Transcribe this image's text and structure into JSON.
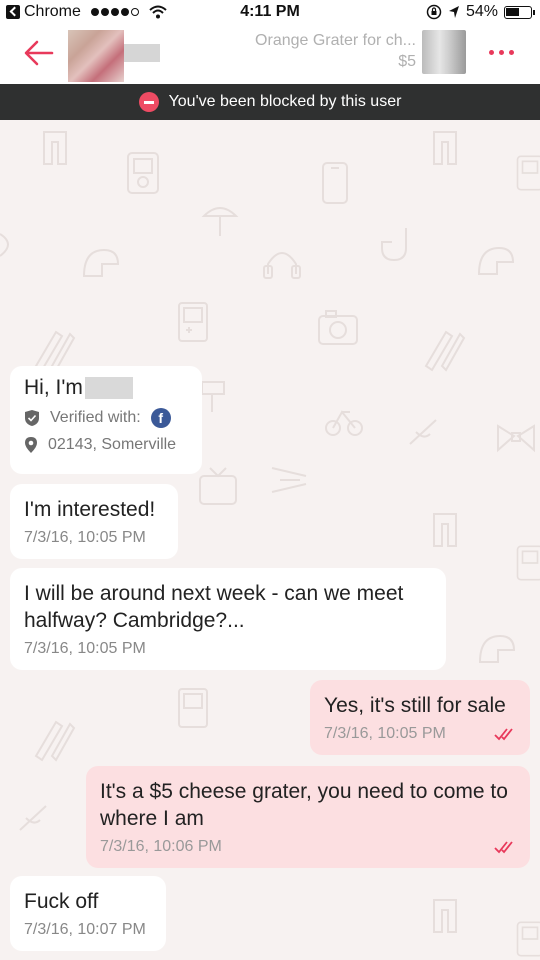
{
  "status_bar": {
    "carrier": "Chrome",
    "time": "4:11 PM",
    "battery_percent": "54%"
  },
  "header": {
    "listing_title": "Orange Grater for ch...",
    "listing_price": "$5"
  },
  "banner": {
    "text": "You've been blocked by this user"
  },
  "profile_card": {
    "greeting": "Hi, I'm",
    "verified_label": "Verified with:",
    "verified_provider": "f",
    "location": "02143, Somerville"
  },
  "messages": [
    {
      "direction": "in",
      "text": "I'm interested!",
      "timestamp": "7/3/16, 10:05 PM"
    },
    {
      "direction": "in",
      "text": "I will be around next week - can we meet halfway? Cambridge?...",
      "timestamp": "7/3/16, 10:05 PM"
    },
    {
      "direction": "out",
      "text": "Yes, it's still for sale",
      "timestamp": "7/3/16, 10:05 PM"
    },
    {
      "direction": "out",
      "text": "It's a $5 cheese grater, you need to come to where I am",
      "timestamp": "7/3/16, 10:06 PM"
    },
    {
      "direction": "in",
      "text": "Fuck off",
      "timestamp": "7/3/16, 10:07 PM"
    }
  ],
  "colors": {
    "accent": "#e8395b",
    "banner_bg": "#2f3030",
    "outgoing_bubble": "#fcdfe1",
    "incoming_bubble": "#ffffff",
    "chat_background": "#f7f2f1"
  }
}
